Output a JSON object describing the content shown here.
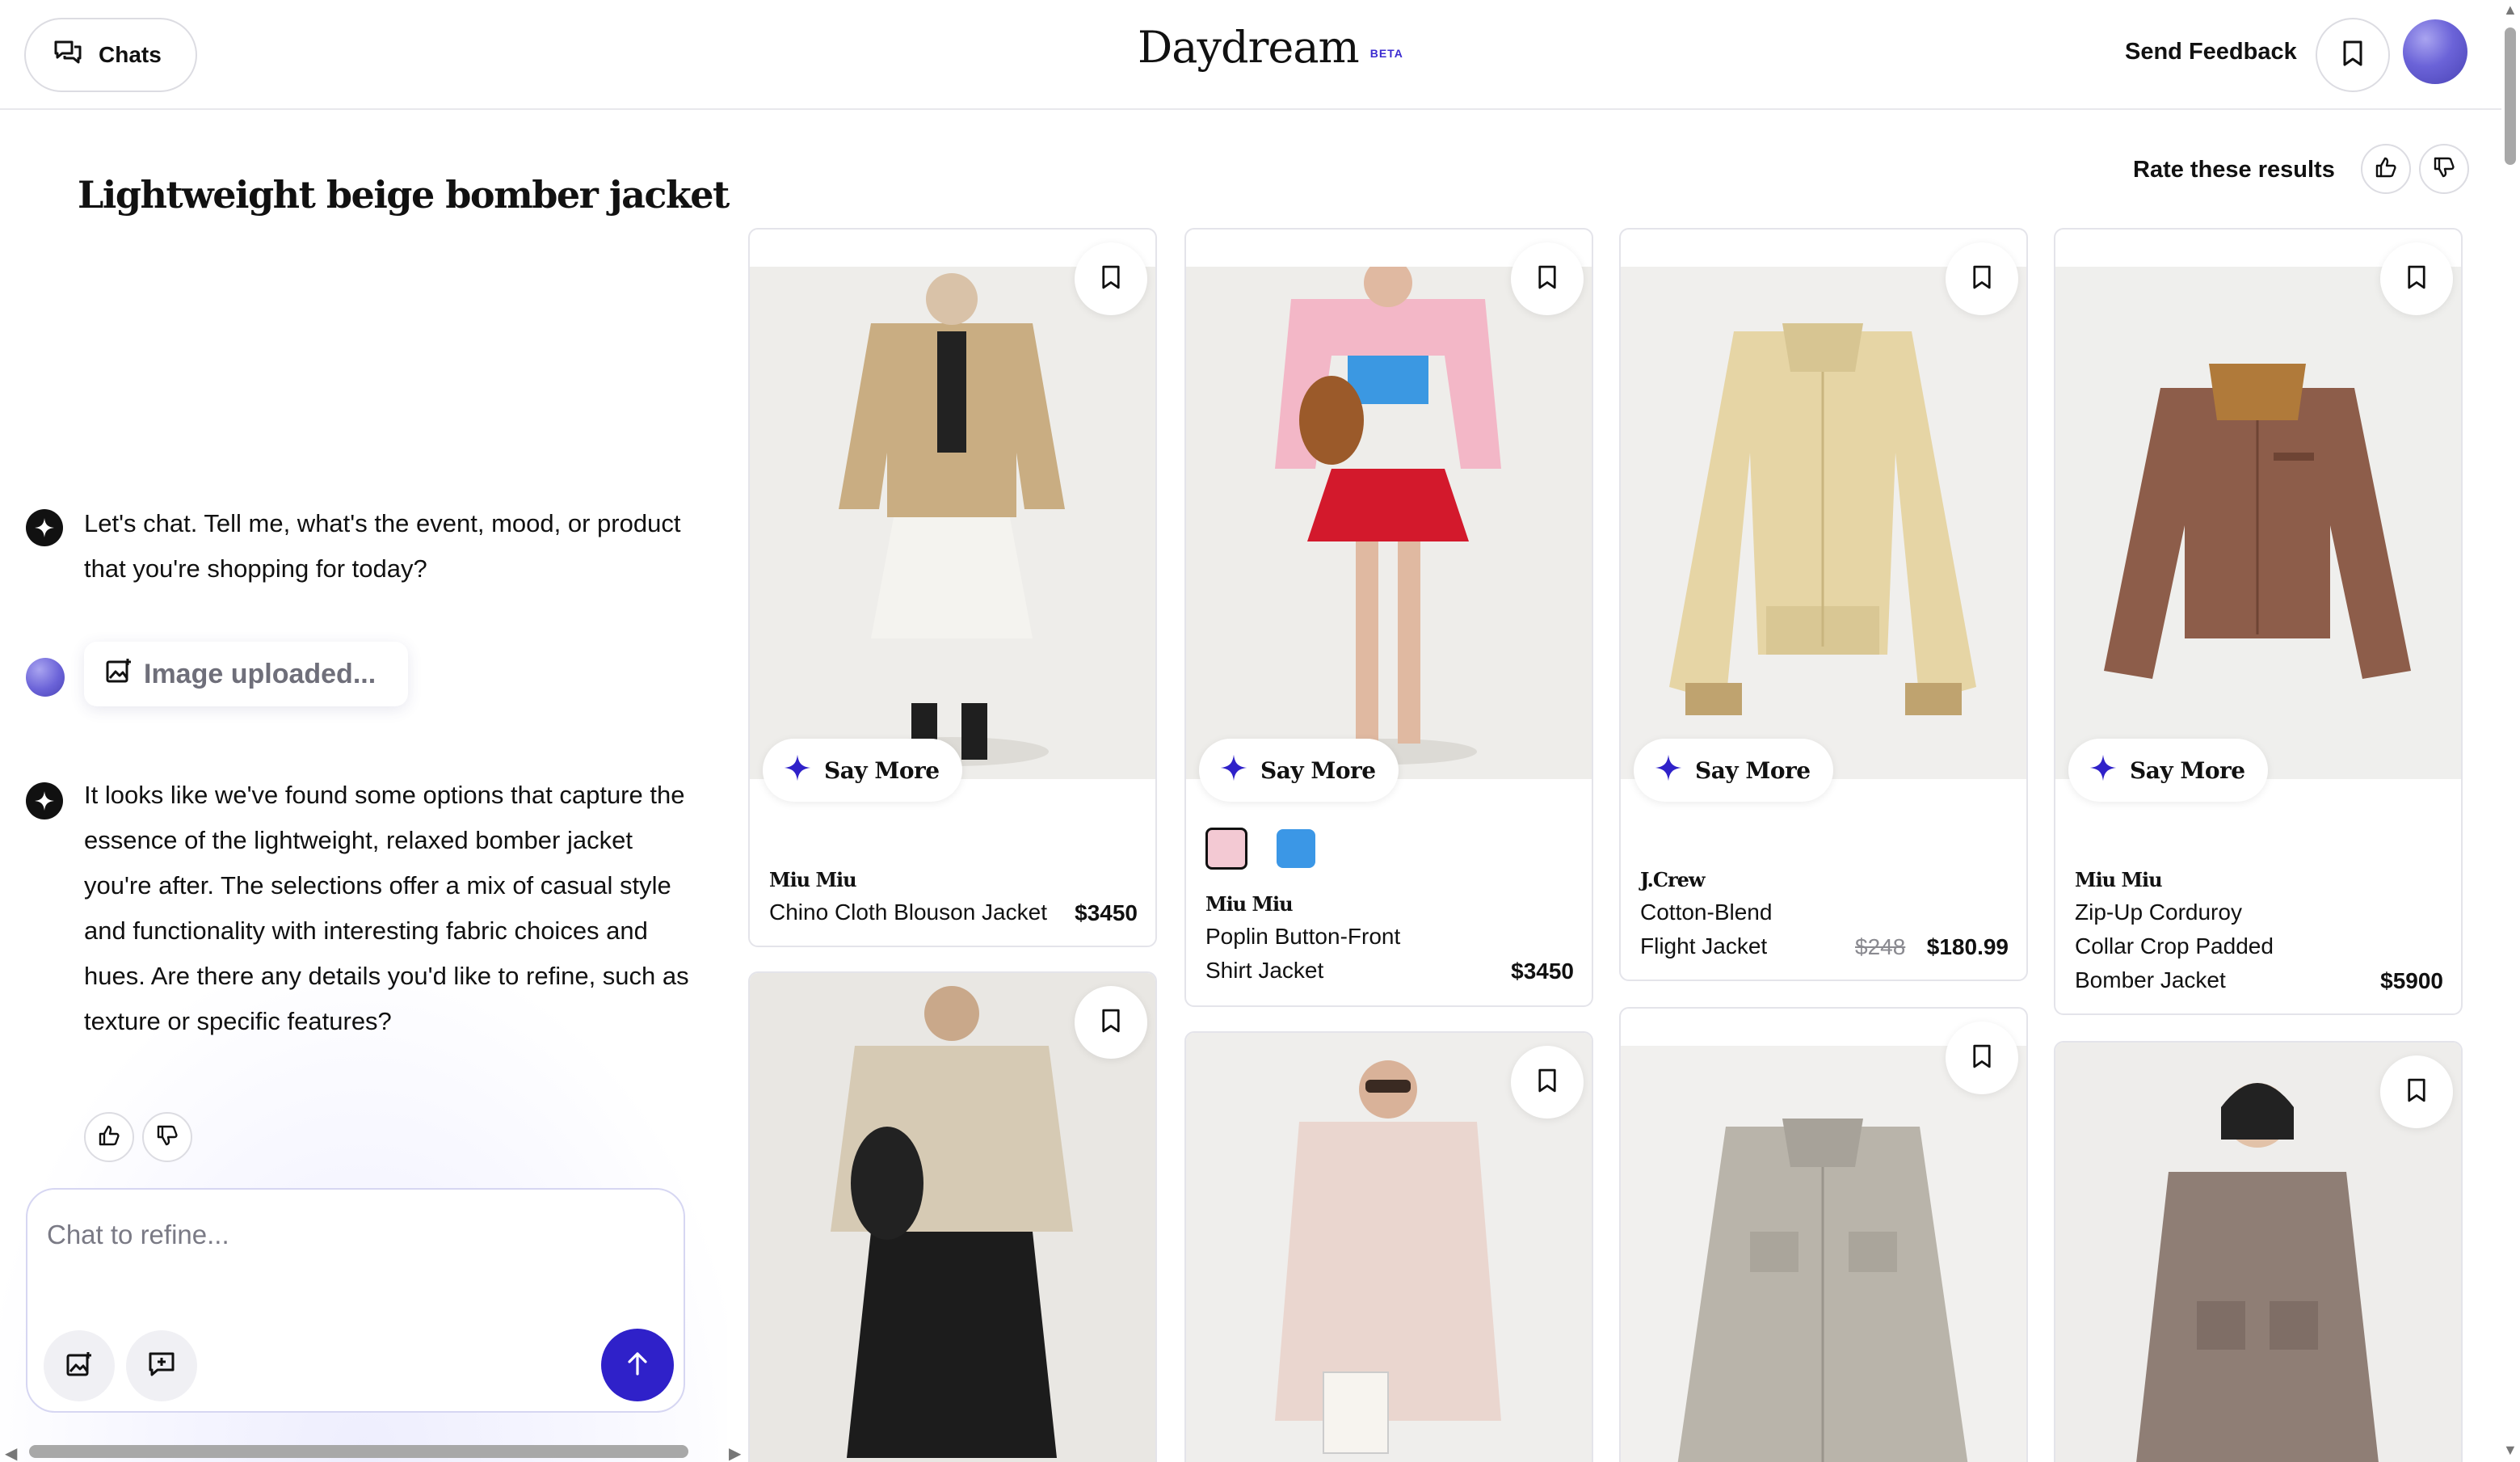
{
  "header": {
    "chats_label": "Chats",
    "logo": "Daydream",
    "beta": "BETA",
    "send_feedback": "Send Feedback"
  },
  "chat": {
    "query_title": "Lightweight beige bomber jacket",
    "messages": [
      {
        "role": "assistant",
        "text": "Let's chat. Tell me, what's the event, mood, or product that you're shopping for today?"
      },
      {
        "role": "user",
        "text": "Image uploaded..."
      },
      {
        "role": "assistant",
        "text": "It looks like we've found some options that capture the essence of the lightweight, relaxed bomber jacket you're after. The selections offer a mix of casual style and functionality with interesting fabric choices and hues. Are there any details you'd like to refine, such as texture or specific features?"
      }
    ],
    "input_placeholder": "Chat to refine..."
  },
  "results": {
    "rate_label": "Rate these results",
    "say_more": "Say More",
    "products": [
      {
        "brand": "Miu Miu",
        "name": "Chino Cloth Blouson Jacket",
        "price": "$3450",
        "image_color": "#d8bf98"
      },
      {
        "brand": "Miu Miu",
        "name_lines": [
          "Poplin Button-Front",
          "Shirt Jacket"
        ],
        "price": "$3450",
        "image_color": "#f4b9c9",
        "swatches": [
          "#f3c9d3",
          "#3b97e6"
        ]
      },
      {
        "brand": "J.Crew",
        "name_lines": [
          "Cotton-Blend",
          "Flight Jacket"
        ],
        "price_old": "$248",
        "price": "$180.99",
        "image_color": "#e9d8a8"
      },
      {
        "brand": "Miu Miu",
        "name_lines": [
          "Zip-Up Corduroy",
          "Collar Crop Padded",
          "Bomber Jacket"
        ],
        "price": "$5900",
        "image_color": "#8c5d4c"
      }
    ],
    "second_row_colors": [
      "#cfc4b1",
      "#e8d3cc",
      "#b7b1a8",
      "#8f7e75"
    ]
  },
  "colors": {
    "accent": "#2f21c9",
    "border": "#e4e4ea"
  }
}
